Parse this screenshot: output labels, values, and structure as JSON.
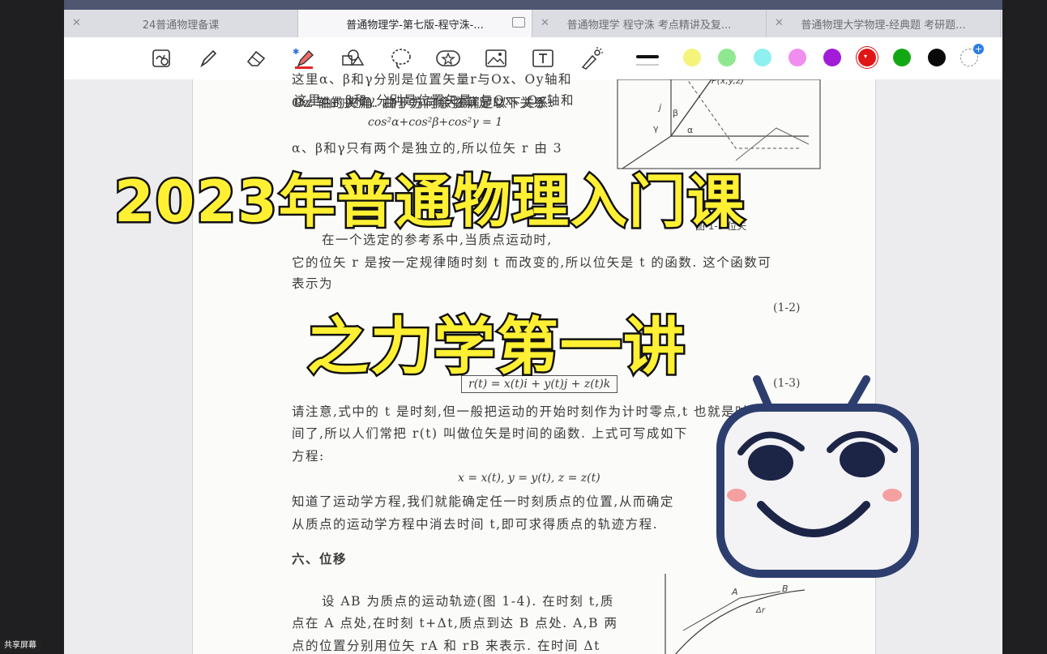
{
  "tabs": [
    {
      "label": "24普通物理备课",
      "active": false
    },
    {
      "label": "普通物理学-第七版-程守洙-...",
      "active": true
    },
    {
      "label": "普通物理学 程守洙 考点精讲及复...",
      "active": false
    },
    {
      "label": "普通物理大学物理-经典题 考研题...",
      "active": false
    }
  ],
  "tools": [
    "lasso-zoom-icon",
    "pen-icon",
    "eraser-icon",
    "highlighter-icon",
    "shapes-icon",
    "lasso-icon",
    "sticker-icon",
    "image-icon",
    "text-icon",
    "laser-pointer-icon"
  ],
  "colors": [
    "#f4f47a",
    "#8fe88f",
    "#8ef0f0",
    "#f08ef0",
    "#a21bd6",
    "#e01515",
    "#13a813",
    "#0a0a0a"
  ],
  "document": {
    "line1": "这里α、β和γ分别是位置矢量r与Ox、Oy轴和",
    "line2": "Oz 轴的夹角. 由于方向余弦满足以下关系:",
    "equation1": "cos²α+cos²β+cos²γ = 1",
    "line3": "α、β和γ只有两个是独立的,所以位矢 r 由 3",
    "fig_caption": "图 1-3  位矢",
    "para1": "在一个选定的参考系中,当质点运动时,",
    "para2": "它的位矢 r 是按一定规律随时刻 t 而改变的,所以位矢是 t 的函数. 这个函数可",
    "para3": "表示为",
    "eqnum2": "(1-2)",
    "eq3": "r(t) = x(t)i + y(t)j + z(t)k",
    "eqnum3": "(1-3)",
    "para4": "请注意,式中的 t 是时刻,但一般把运动的开始时刻作为计时零点,t 也就是时",
    "para5": "间了,所以人们常把 r(t) 叫做位矢是时间的函数. 上式可写成如下",
    "para6": "方程:",
    "eq4": "x = x(t),   y = y(t),   z = z(t)",
    "para7": "知道了运动学方程,我们就能确定任一时刻质点的位置,从而确定",
    "para8": "从质点的运动学方程中消去时间 t,即可求得质点的轨迹方程.",
    "section": "六、位移",
    "para9": "设 AB 为质点的运动轨迹(图 1-4). 在时刻 t,质",
    "para10": "点在 A 点处,在时刻 t+Δt,质点到达 B 点处. A,B 两",
    "para11": "点的位置分别用位矢 rA 和 rB 来表示. 在时间 Δt"
  },
  "overlay": {
    "title_line1": "2023年普通物理入门课",
    "title_line2": "之力学第一讲"
  },
  "share_label": "共享屏幕"
}
